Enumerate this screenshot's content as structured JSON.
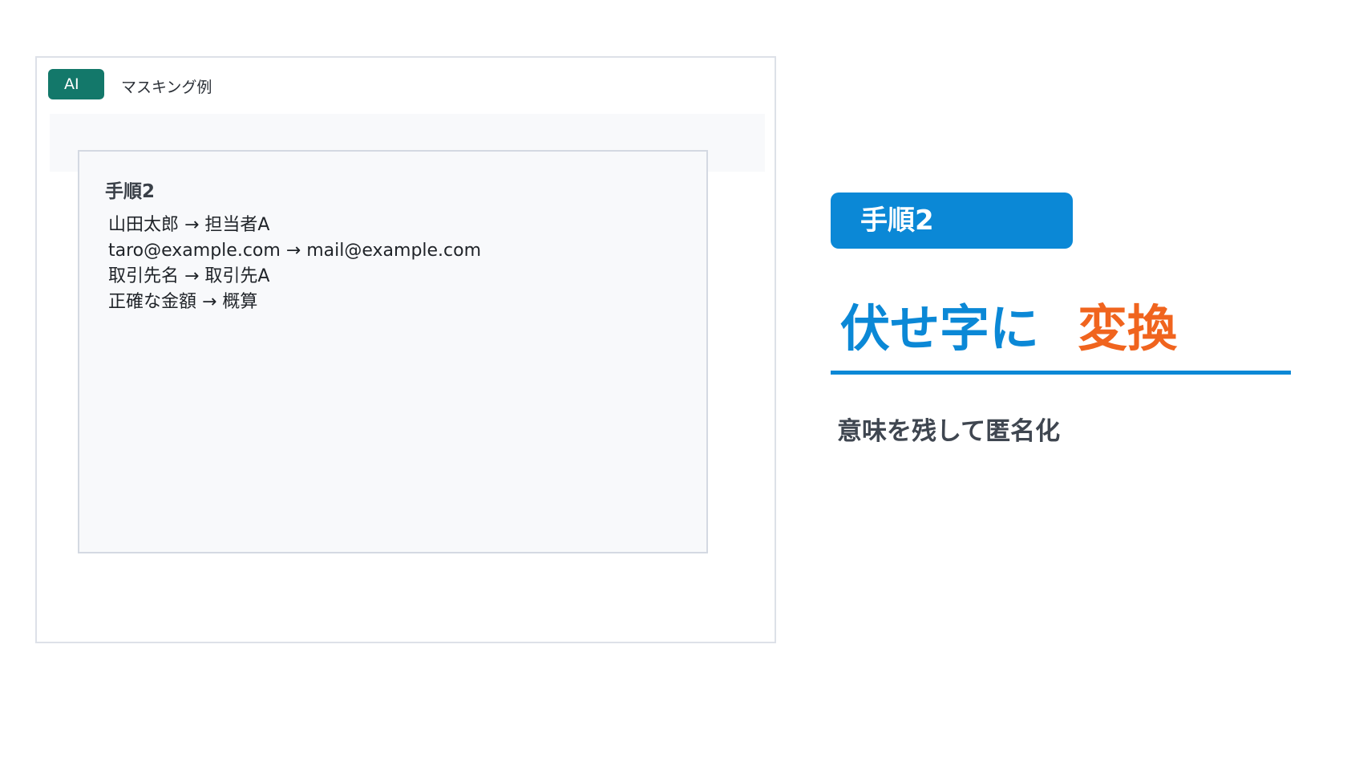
{
  "window": {
    "badge": "AI",
    "title": "マスキング例"
  },
  "card": {
    "heading": "手順2",
    "lines": [
      "山田太郎 → 担当者A",
      "taro@example.com → mail@example.com",
      "取引先名 → 取引先A",
      "正確な金額 → 概算"
    ]
  },
  "panel": {
    "step_label": "手順2",
    "heading_part1": "伏せ字に",
    "heading_part2": "変換",
    "subtext": "意味を残して匿名化"
  },
  "colors": {
    "badge": "#13786a",
    "accent_blue": "#0b88d6",
    "accent_orange": "#f0641e"
  }
}
